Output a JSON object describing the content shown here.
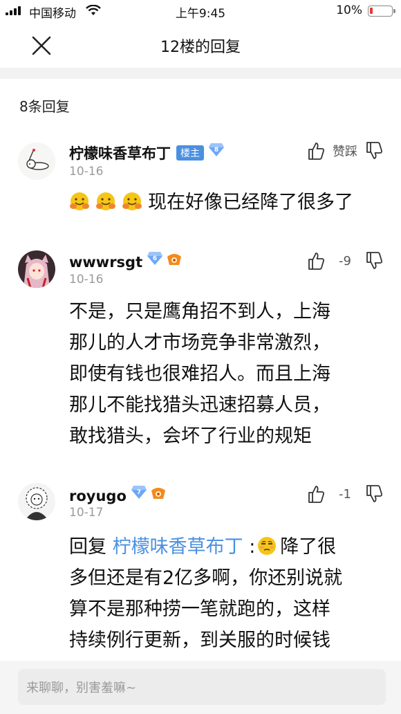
{
  "status_bar": {
    "carrier": "中国移动",
    "time": "上午9:45",
    "battery": "10%"
  },
  "nav": {
    "title": "12楼的回复"
  },
  "reply_count": "8条回复",
  "comments": [
    {
      "username": "柠檬味香草布丁",
      "owner_badge": "楼主",
      "level": "8",
      "date": "10-16",
      "vote_label": "赞踩",
      "text": "现在好像已经降了很多了"
    },
    {
      "username": "wwwrsgt",
      "level": "6",
      "date": "10-16",
      "vote_label": "-9",
      "text_lines": [
        "不是，只是鹰角招不到人，上海",
        "那儿的人才市场竞争非常激烈，",
        "即使有钱也很难招人。而且上海",
        "那儿不能找猎头迅速招募人员，",
        "敢找猎头，会坏了行业的规矩"
      ]
    },
    {
      "username": "royugo",
      "level": "7",
      "date": "10-17",
      "vote_label": "-1",
      "reply_prefix": "回复",
      "mention": "柠檬味香草布丁",
      "reply_sep": ":",
      "text_first": "降了很",
      "text_lines": [
        "多但还是有2亿多啊，你还别说就",
        "算不是那种捞一笔就跑的，这样",
        "持续例行更新，到关服的时候钱"
      ]
    }
  ],
  "input": {
    "placeholder": "来聊聊，别害羞嘛~"
  },
  "colors": {
    "accent": "#4a90e2",
    "battery_low": "#e53935"
  }
}
